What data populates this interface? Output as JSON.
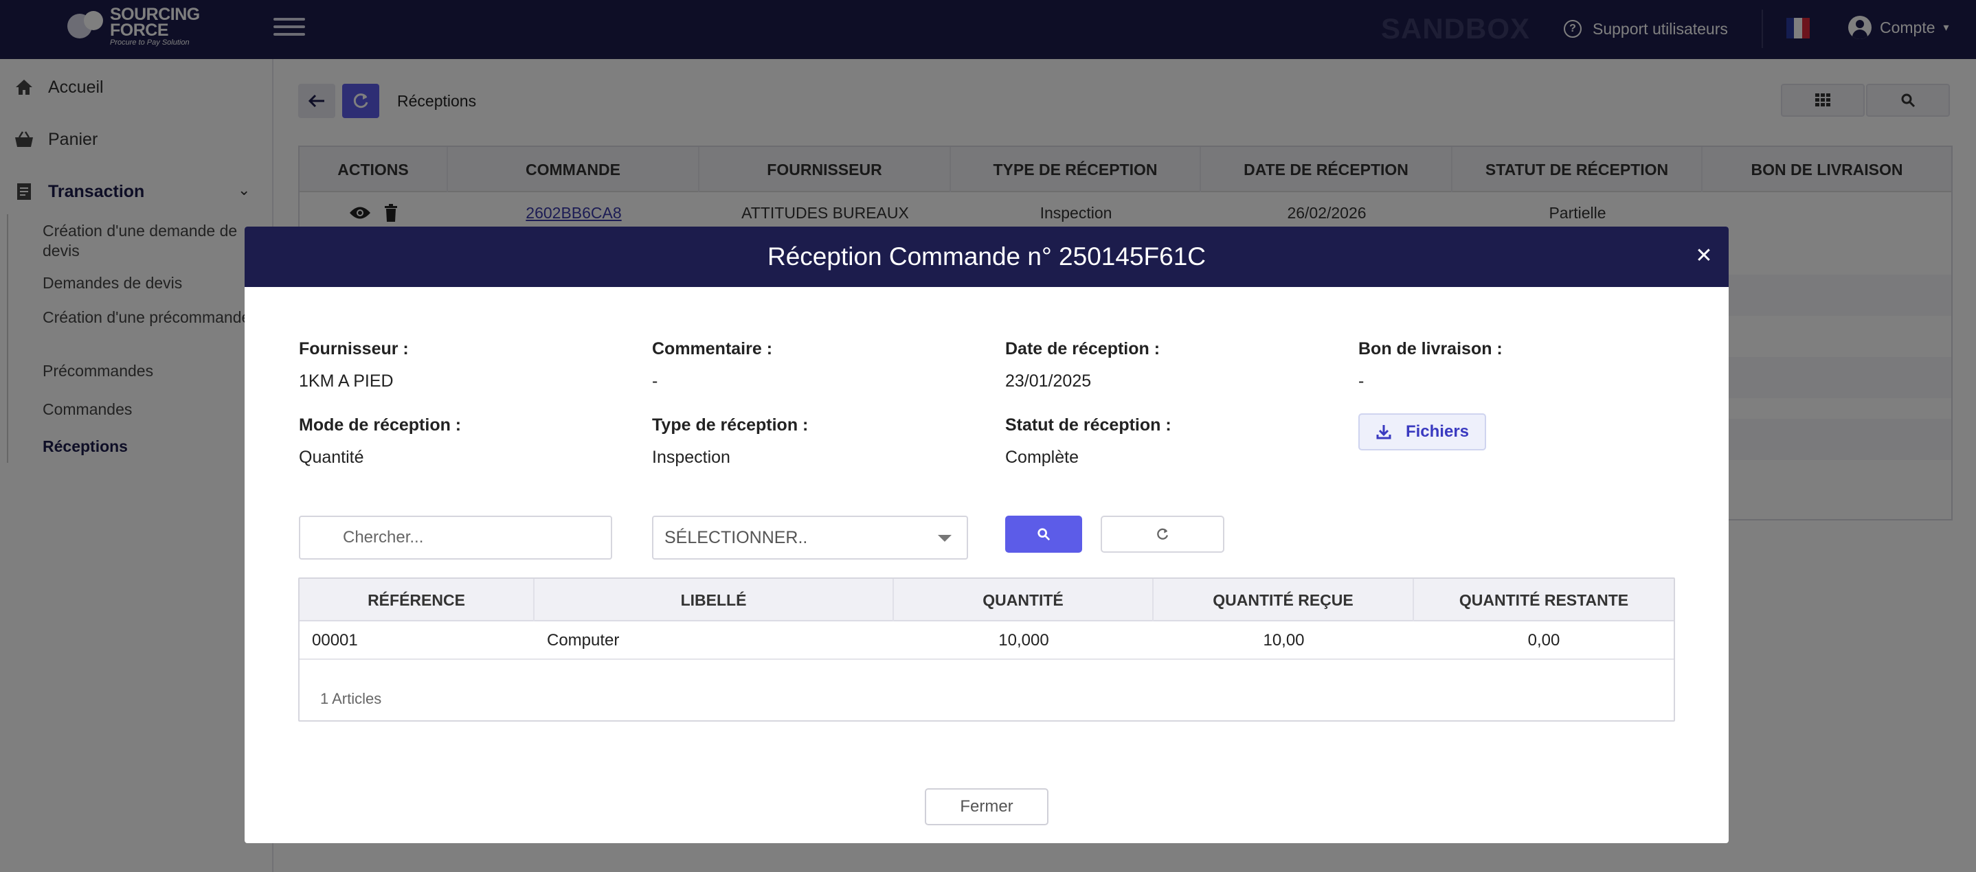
{
  "topbar": {
    "logo_line1": "SOURCING",
    "logo_line2": "FORCE",
    "logo_tagline": "Procure to Pay Solution",
    "env_label": "SANDBOX",
    "support_label": "Support utilisateurs",
    "account_label": "Compte",
    "bg_color": "#1c1c4c"
  },
  "sidebar": {
    "items": [
      {
        "label": "Accueil",
        "icon": "home-icon"
      },
      {
        "label": "Panier",
        "icon": "basket-icon"
      },
      {
        "label": "Transaction",
        "icon": "receipt-icon"
      }
    ],
    "sub_items": [
      {
        "label": "Création d'une demande de devis"
      },
      {
        "label": "Demandes de devis"
      },
      {
        "label": "Création d'une précommande"
      },
      {
        "label": "Précommandes"
      },
      {
        "label": "Commandes"
      },
      {
        "label": "Réceptions"
      }
    ]
  },
  "page": {
    "title": "Réceptions",
    "table": {
      "columns": [
        "ACTIONS",
        "COMMANDE",
        "FOURNISSEUR",
        "TYPE DE RÉCEPTION",
        "DATE DE RÉCEPTION",
        "STATUT DE RÉCEPTION",
        "BON DE LIVRAISON"
      ],
      "rows": [
        {
          "commande": "2602BB6CA8",
          "fournisseur": "ATTITUDES BUREAUX",
          "type": "Inspection",
          "date": "26/02/2026",
          "statut": "Partielle",
          "bon": ""
        }
      ]
    }
  },
  "modal": {
    "title": "Réception Commande n° 250145F61C",
    "fields": {
      "fournisseur_label": "Fournisseur :",
      "fournisseur_value": "1KM A PIED",
      "commentaire_label": "Commentaire :",
      "commentaire_value": "-",
      "date_label": "Date de réception :",
      "date_value": "23/01/2025",
      "bon_label": "Bon de livraison :",
      "bon_value": "-",
      "mode_label": "Mode de réception :",
      "mode_value": "Quantité",
      "type_label": "Type de réception :",
      "type_value": "Inspection",
      "statut_label": "Statut de réception :",
      "statut_value": "Complète"
    },
    "files_label": "Fichiers",
    "search_placeholder": "Chercher...",
    "select_value": "SÉLECTIONNER..",
    "table": {
      "columns": [
        "RÉFÉRENCE",
        "LIBELLÉ",
        "QUANTITÉ",
        "QUANTITÉ REÇUE",
        "QUANTITÉ RESTANTE"
      ],
      "rows": [
        {
          "reference": "00001",
          "libelle": "Computer",
          "quantite": "10,000",
          "recue": "10,00",
          "restante": "0,00"
        }
      ],
      "footer": "1 Articles"
    },
    "close_label": "Fermer"
  },
  "colors": {
    "accent": "#5c5ce8",
    "navy": "#1c1c4c",
    "link": "#3838a8"
  }
}
